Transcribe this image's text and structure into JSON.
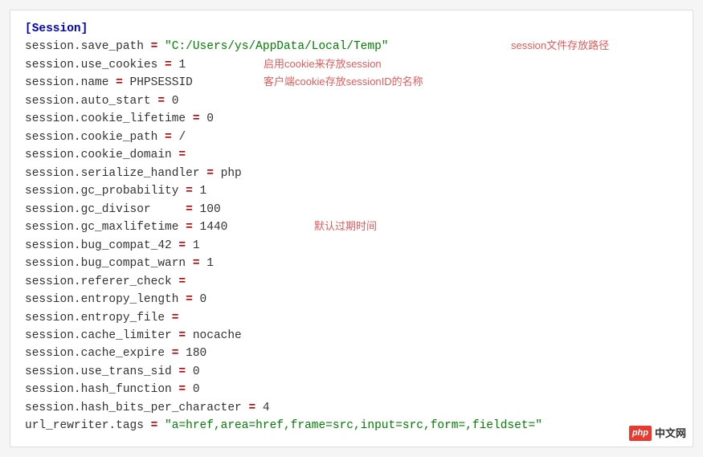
{
  "header": "[Session]",
  "lines": [
    {
      "key": "session.save_path",
      "eq": " = ",
      "val": "\"C:/Users/ys/AppData/Local/Temp\"",
      "val_class": "str",
      "annot": "session文件存放路径",
      "annot_class": "a1"
    },
    {
      "key": "session.use_cookies",
      "eq": " = ",
      "val": "1",
      "annot": "启用cookie来存放session",
      "annot_class": "a2"
    },
    {
      "key": "session.name",
      "eq": " = ",
      "val": "PHPSESSID",
      "annot": "客户端cookie存放sessionID的名称",
      "annot_class": "a3"
    },
    {
      "key": "session.auto_start",
      "eq": " = ",
      "val": "0"
    },
    {
      "key": "session.cookie_lifetime",
      "eq": " = ",
      "val": "0"
    },
    {
      "key": "session.cookie_path",
      "eq": " = ",
      "val": "/"
    },
    {
      "key": "session.cookie_domain",
      "eq": " =",
      "val": ""
    },
    {
      "key": "session.serialize_handler",
      "eq": " = ",
      "val": "php"
    },
    {
      "key": "session.gc_probability",
      "eq": " = ",
      "val": "1"
    },
    {
      "key": "session.gc_divisor    ",
      "eq": " = ",
      "val": "100"
    },
    {
      "key": "session.gc_maxlifetime",
      "eq": " = ",
      "val": "1440",
      "annot": "默认过期时间",
      "annot_class": "a4"
    },
    {
      "key": "session.bug_compat_42",
      "eq": " = ",
      "val": "1"
    },
    {
      "key": "session.bug_compat_warn",
      "eq": " = ",
      "val": "1"
    },
    {
      "key": "session.referer_check",
      "eq": " =",
      "val": ""
    },
    {
      "key": "session.entropy_length",
      "eq": " = ",
      "val": "0"
    },
    {
      "key": "session.entropy_file",
      "eq": " =",
      "val": ""
    },
    {
      "key": "session.cache_limiter",
      "eq": " = ",
      "val": "nocache"
    },
    {
      "key": "session.cache_expire",
      "eq": " = ",
      "val": "180"
    },
    {
      "key": "session.use_trans_sid",
      "eq": " = ",
      "val": "0"
    },
    {
      "key": "session.hash_function",
      "eq": " = ",
      "val": "0"
    },
    {
      "key": "session.hash_bits_per_character",
      "eq": " = ",
      "val": "4"
    },
    {
      "key": "url_rewriter.tags",
      "eq": " = ",
      "val": "\"a=href,area=href,frame=src,input=src,form=,fieldset=\"",
      "val_class": "str"
    }
  ],
  "watermark": {
    "badge": "php",
    "text": "中文网"
  }
}
